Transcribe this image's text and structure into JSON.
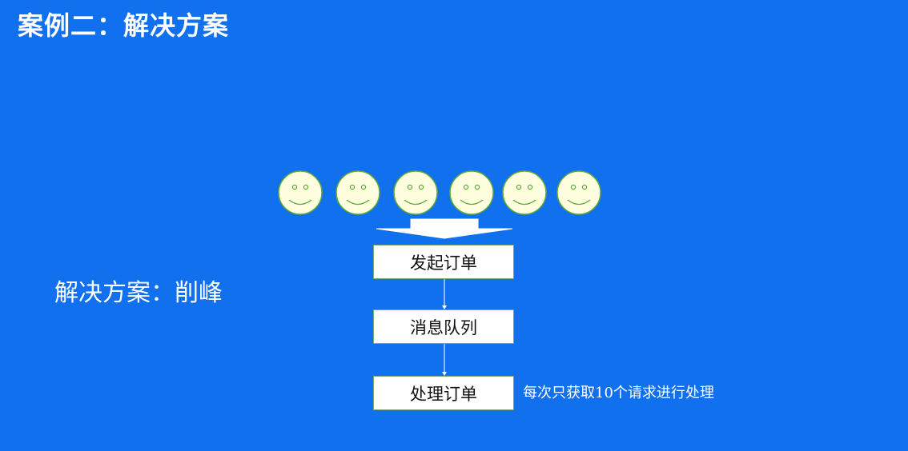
{
  "title": "案例二：解决方案",
  "solution_label": "解决方案：削峰",
  "faces": [
    {
      "icon": "smiley-face-icon"
    },
    {
      "icon": "smiley-face-icon"
    },
    {
      "icon": "smiley-face-icon"
    },
    {
      "icon": "smiley-face-icon"
    },
    {
      "icon": "smiley-face-icon"
    },
    {
      "icon": "smiley-face-icon"
    }
  ],
  "flow": {
    "steps": [
      {
        "label": "发起订单"
      },
      {
        "label": "消息队列"
      },
      {
        "label": "处理订单"
      }
    ],
    "note": "每次只获取10个请求进行处理"
  },
  "colors": {
    "background": "#1170ed",
    "face_fill": "#ffffe0",
    "face_stroke": "#5fa83a",
    "box_border": "#7ea86a"
  }
}
